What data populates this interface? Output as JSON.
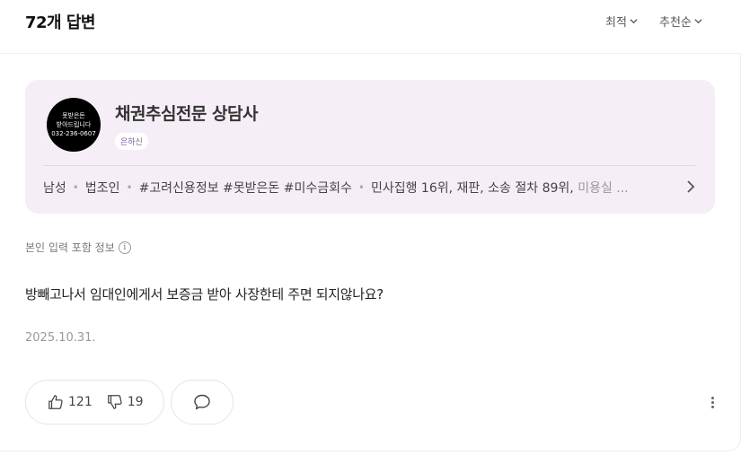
{
  "header": {
    "answer_count": "72개 답변",
    "sort_latest": "최적",
    "sort_recommend": "추천순"
  },
  "profile": {
    "avatar_text": [
      "못받은돈",
      "받아드립니다",
      "032-236-0607"
    ],
    "name": "채권추심전문 상담사",
    "badge": "은하신",
    "tags": {
      "gender": "남성",
      "role": "법조인",
      "hashtags": "#고려신용정보 #못받은돈 #미수금회수",
      "rank": "민사집행 16위, 재판, 소송 절차 89위,",
      "rank_fade": "미용실 ..."
    }
  },
  "info_note": "본인 입력 포함 정보",
  "question": "방빼고나서 임대인에게서 보증금 받아 사장한테 주면 되지않나요?",
  "date": "2025.10.31.",
  "reactions": {
    "like_count": "121",
    "dislike_count": "19"
  },
  "icons": [
    "chevron-down-icon",
    "chevron-right-icon",
    "info-icon",
    "thumbs-up-icon",
    "thumbs-down-icon",
    "comment-icon",
    "more-vertical-icon"
  ]
}
